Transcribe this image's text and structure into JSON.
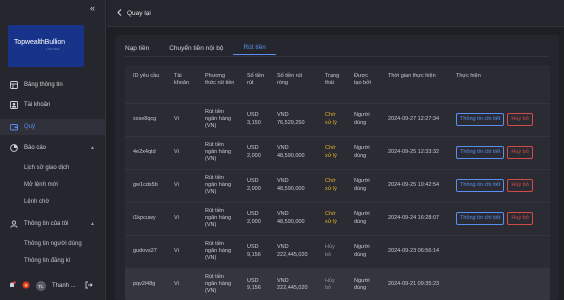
{
  "sidebar": {
    "collapse_glyph": "«",
    "logo": {
      "name": "TopwealthBullion",
      "sub": "LIMITED"
    },
    "items": [
      {
        "label": "Bảng thông tin",
        "icon": "dashboard-icon"
      },
      {
        "label": "Tài khoản",
        "icon": "account-icon"
      },
      {
        "label": "Quỹ",
        "icon": "wallet-icon"
      },
      {
        "label": "Báo cáo",
        "icon": "report-icon"
      },
      {
        "label": "Thông tin của tôi",
        "icon": "user-info-icon"
      }
    ],
    "report_subitems": [
      "Lịch sử giao dịch",
      "Mở lệnh mới",
      "Lệnh chờ"
    ],
    "info_subitems": [
      "Thông tin người dùng",
      "Thông tin đăng kí"
    ],
    "bottom": {
      "avatar": "TL",
      "user": "Thanh ..."
    }
  },
  "topbar": {
    "back_label": "Quay lại"
  },
  "tabs": [
    "Nạp tiền",
    "Chuyển tiền nội bộ",
    "Rút tiền"
  ],
  "table": {
    "headers": [
      "ID yêu cầu",
      "Tài khoản",
      "Phương thức rút tiền",
      "Số tiền rút",
      "Số tiền rút ròng",
      "Trạng thái",
      "Được tạo bởi",
      "Thời gian thực hiện",
      "Thực hiện"
    ],
    "detail_label": "Thông tin chi tiết",
    "cancel_label": "Huỷ bỏ",
    "rows": [
      {
        "id": "xxse8qcg",
        "account": "Vi",
        "method": "Rút tiền ngân hàng (VN)",
        "amount": "USD 3,150",
        "net": "VND 76,529,250",
        "status": "Chờ xử lý",
        "by": "Người dùng",
        "time": "2024-09-27 12:27:34"
      },
      {
        "id": "4e2x4qtd",
        "account": "Vi",
        "method": "Rút tiền ngân hàng (VN)",
        "amount": "USD 2,000",
        "net": "VND 48,590,000",
        "status": "Chờ xử lý",
        "by": "Người dùng",
        "time": "2024-09-25 12:33:32"
      },
      {
        "id": "gw1cds5b",
        "account": "Vi",
        "method": "Rút tiền ngân hàng (VN)",
        "amount": "USD 2,000",
        "net": "VND 48,590,000",
        "status": "Chờ xử lý",
        "by": "Người dùng",
        "time": "2024-09-25 10:42:54"
      },
      {
        "id": "i1kpcuwy",
        "account": "Vi",
        "method": "Rút tiền ngân hàng (VN)",
        "amount": "USD 2,000",
        "net": "VND 48,590,000",
        "status": "Chờ xử lý",
        "by": "Người dùng",
        "time": "2024-09-24 16:28:07"
      },
      {
        "id": "gudovs27",
        "account": "Vi",
        "method": "Rút tiền ngân hàng (VN)",
        "amount": "USD 9,156",
        "net": "VND 222,445,020",
        "status": "Hủy bỏ",
        "by": "Người dùng",
        "time": "2024-09-23 06:56:14"
      },
      {
        "id": "pqv2i48g",
        "account": "Vi",
        "method": "Rút tiền ngân hàng (VN)",
        "amount": "USD 9,156",
        "net": "VND 222,445,020",
        "status": "Hủy bỏ",
        "by": "Người dùng",
        "time": "2024-09-21 09:35:23"
      }
    ]
  },
  "colors": {
    "accent": "#5a8ef0",
    "pending": "#e0b22a",
    "danger": "#d24b48",
    "logo_bg": "#18338a"
  }
}
